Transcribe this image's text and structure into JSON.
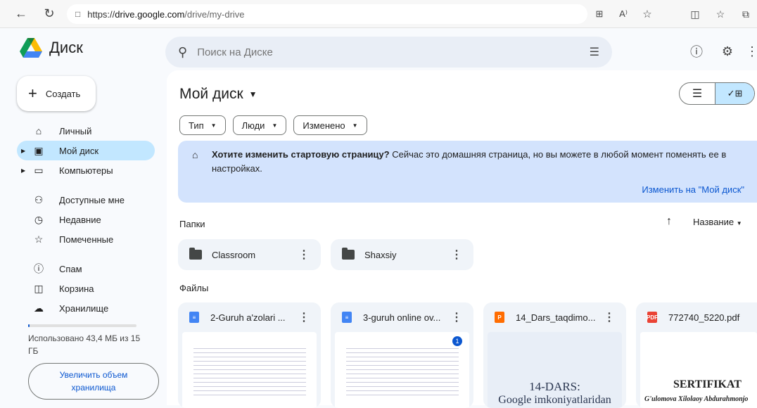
{
  "browser": {
    "url_prefix": "https://",
    "url_host": "drive.google.com",
    "url_path": "/drive/my-drive"
  },
  "app": {
    "name": "Диск"
  },
  "search": {
    "placeholder": "Поиск на Диске"
  },
  "create_label": "Создать",
  "sidebar": {
    "items": [
      {
        "label": "Личный",
        "icon": "home-icon"
      },
      {
        "label": "Мой диск",
        "icon": "drive-icon"
      },
      {
        "label": "Компьютеры",
        "icon": "computer-icon"
      },
      {
        "label": "Доступные мне",
        "icon": "people-icon"
      },
      {
        "label": "Недавние",
        "icon": "clock-icon"
      },
      {
        "label": "Помеченные",
        "icon": "star-icon"
      },
      {
        "label": "Спам",
        "icon": "spam-icon"
      },
      {
        "label": "Корзина",
        "icon": "trash-icon"
      },
      {
        "label": "Хранилище",
        "icon": "cloud-icon"
      }
    ],
    "storage_text": "Использовано 43,4 МБ из 15 ГБ",
    "upgrade_label": "Увеличить объем хранилища"
  },
  "main": {
    "title": "Мой диск",
    "filters": [
      "Тип",
      "Люди",
      "Изменено"
    ],
    "banner": {
      "bold": "Хотите изменить стартовую страницу?",
      "text": " Сейчас это домашняя страница, но вы можете в любой момент поменять ее в настройках.",
      "link": "Изменить на \"Мой диск\""
    },
    "folders_label": "Папки",
    "sort_label": "Название",
    "folders": [
      "Classroom",
      "Shaxsiy"
    ],
    "files_label": "Файлы",
    "files": [
      {
        "name": "2-Guruh a'zolari ...",
        "type": "doc",
        "color": "#4285f4"
      },
      {
        "name": "3-guruh online ov...",
        "type": "doc",
        "color": "#4285f4",
        "badge": "1"
      },
      {
        "name": "14_Dars_taqdimo...",
        "type": "slides",
        "color": "#ff6d01",
        "thumb_title": "14-DARS:",
        "thumb_sub": "Google imkoniyatlaridan"
      },
      {
        "name": "772740_5220.pdf",
        "type": "pdf",
        "color": "#ea4335",
        "thumb_title": "SERTIFIKAT",
        "thumb_sub": "G'ulomova Xilolaoy Abdurahmonjo"
      }
    ]
  }
}
